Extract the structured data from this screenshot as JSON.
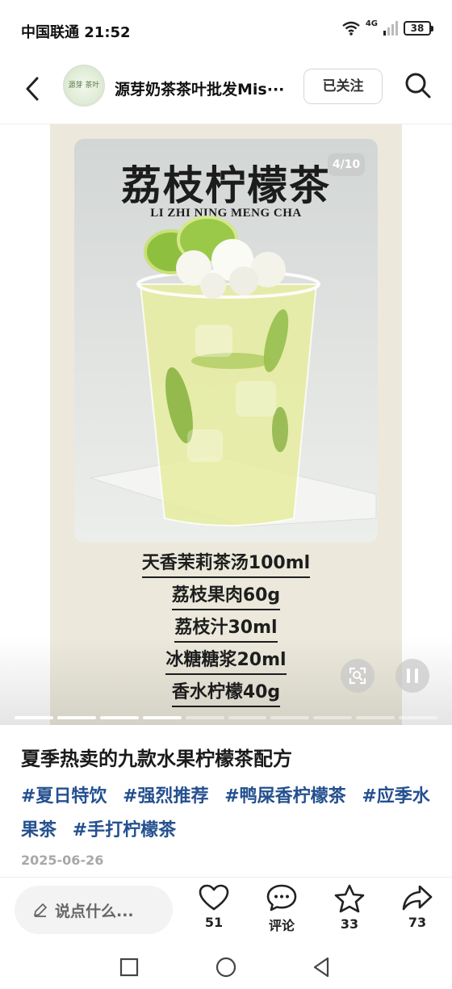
{
  "status_bar": {
    "carrier_time": "中国联通 21:52",
    "network": "4G",
    "battery": "38"
  },
  "header": {
    "avatar_text": "源芽 茶叶",
    "author_name": "源芽奶茶茶叶批发Mis···",
    "follow_label": "已关注"
  },
  "media": {
    "page_counter": "4/10",
    "image_title": "荔枝柠檬茶",
    "image_subtitle": "LI ZHI NING MENG CHA",
    "recipe": [
      "天香茉莉茶汤100ml",
      "荔枝果肉60g",
      "荔枝汁30ml",
      "冰糖糖浆20ml",
      "香水柠檬40g"
    ],
    "progress": {
      "total": 10,
      "current": 4
    }
  },
  "post": {
    "title": "夏季热卖的九款水果柠檬茶配方",
    "tags": [
      "#夏日特饮",
      "#强烈推荐",
      "#鸭屎香柠檬茶",
      "#应季水果茶",
      "#手打柠檬茶"
    ],
    "date": "2025-06-26"
  },
  "actions": {
    "comment_placeholder": "说点什么...",
    "like_count": "51",
    "comment_label": "评论",
    "collect_count": "33",
    "share_count": "73"
  },
  "colors": {
    "tag_blue": "#24508f",
    "card_bg": "#ece9dc",
    "lime_green": "#8fbf3f"
  }
}
